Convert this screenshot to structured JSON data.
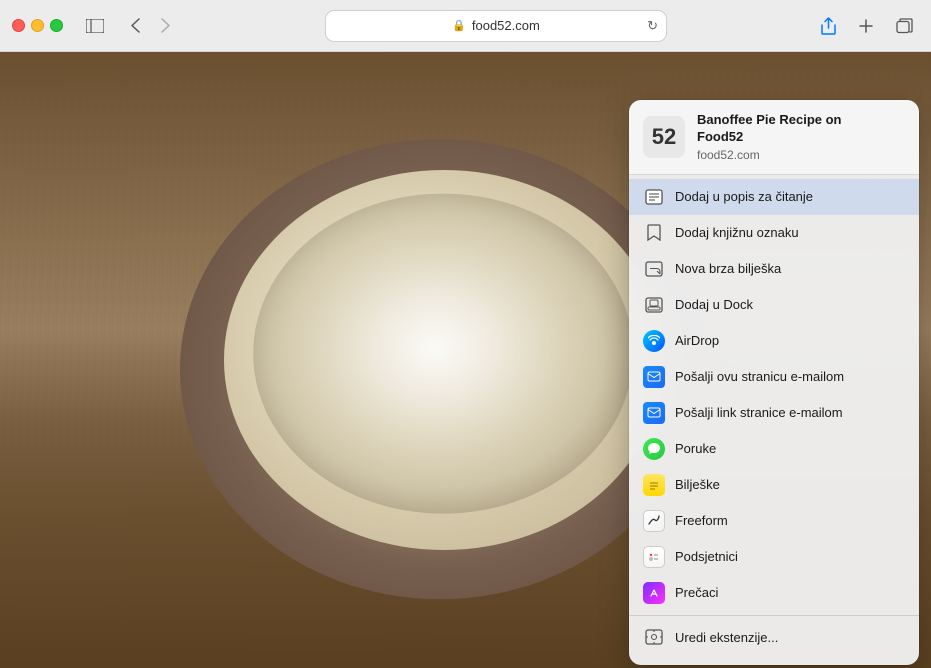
{
  "browser": {
    "url": "food52.com",
    "url_display": "food52.com"
  },
  "page": {
    "title": "Banoffee Pie Recipe on Food52",
    "site_url": "food52.com",
    "site_icon_text": "52"
  },
  "toolbar": {
    "back_label": "‹",
    "forward_label": "›",
    "share_label": "Share",
    "new_tab_label": "+",
    "tabs_label": "⧉"
  },
  "menu": {
    "header": {
      "title": "Banoffee Pie Recipe on\nFood52",
      "url": "food52.com"
    },
    "items": [
      {
        "id": "reading-list",
        "label": "Dodaj u popis za čitanje",
        "icon": "reading-list-icon",
        "active": true
      },
      {
        "id": "bookmark",
        "label": "Dodaj knjižnu oznaku",
        "icon": "bookmark-icon",
        "active": false
      },
      {
        "id": "quick-note",
        "label": "Nova brza bilješka",
        "icon": "quick-note-icon",
        "active": false
      },
      {
        "id": "dock",
        "label": "Dodaj u Dock",
        "icon": "dock-icon",
        "active": false
      },
      {
        "id": "airdrop",
        "label": "AirDrop",
        "icon": "airdrop-icon",
        "active": false
      },
      {
        "id": "mail-page",
        "label": "Pošalji ovu stranicu e-mailom",
        "icon": "mail-page-icon",
        "active": false
      },
      {
        "id": "mail-link",
        "label": "Pošalji link stranice e-mailom",
        "icon": "mail-link-icon",
        "active": false
      },
      {
        "id": "messages",
        "label": "Poruke",
        "icon": "messages-icon",
        "active": false
      },
      {
        "id": "notes",
        "label": "Bilješke",
        "icon": "notes-icon",
        "active": false
      },
      {
        "id": "freeform",
        "label": "Freeform",
        "icon": "freeform-icon",
        "active": false
      },
      {
        "id": "reminders",
        "label": "Podsjetnici",
        "icon": "reminders-icon",
        "active": false
      },
      {
        "id": "shortcuts",
        "label": "Prečaci",
        "icon": "shortcuts-icon",
        "active": false
      },
      {
        "id": "extensions",
        "label": "Uredi ekstenzije...",
        "icon": "extensions-icon",
        "active": false
      }
    ]
  }
}
